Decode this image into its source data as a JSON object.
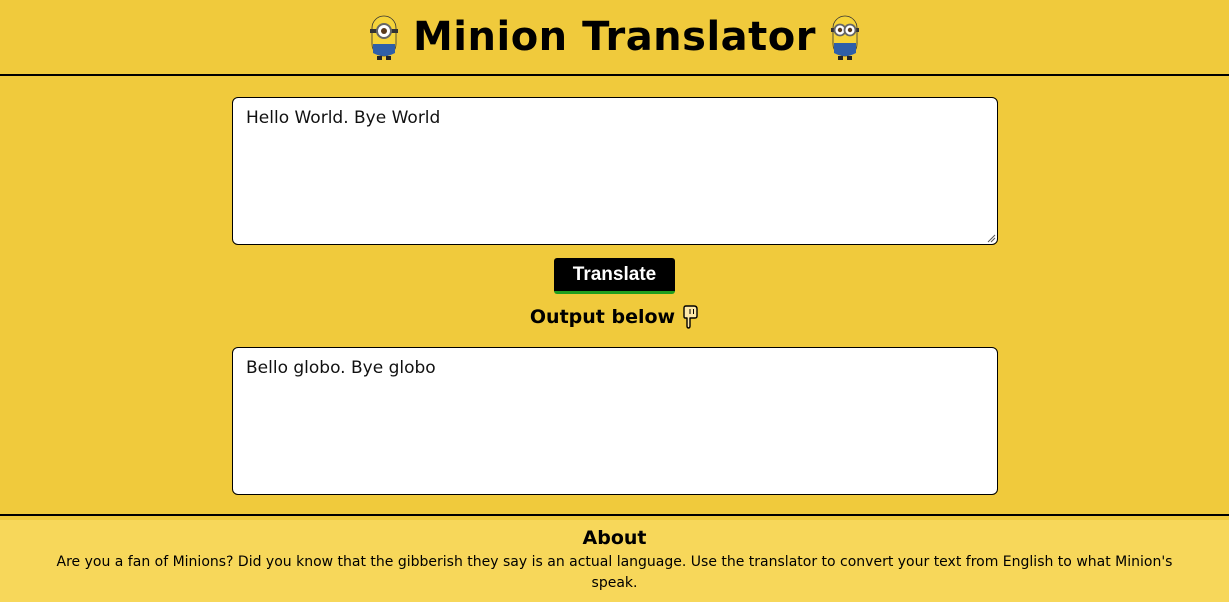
{
  "header": {
    "title": "Minion Translator",
    "left_icon": "minion-one-eye-icon",
    "right_icon": "minion-two-eyes-icon"
  },
  "input": {
    "value": "Hello World. Bye World"
  },
  "translate_button": {
    "label": "Translate"
  },
  "output_label": {
    "text": "Output below",
    "icon": "pointing-down-hand-icon"
  },
  "output": {
    "value": "Bello globo. Bye globo"
  },
  "about": {
    "heading": "About",
    "text": "Are you a fan of Minions? Did you know that the gibberish they say is an actual language. Use the translator to convert your text from English to what Minion's speak."
  },
  "colors": {
    "background": "#f0ca3c",
    "footer_background": "#f7d75a",
    "button": "#000000",
    "button_accent": "#1f9d1f"
  }
}
